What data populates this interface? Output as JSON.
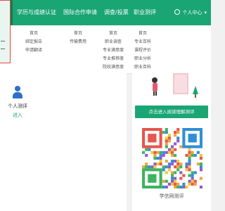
{
  "nav": {
    "active_fragment": "报告",
    "items": [
      {
        "label": "学历与成绩认证"
      },
      {
        "label": "国际合作申请"
      },
      {
        "label": "调查/投票"
      },
      {
        "label": "职业测评"
      }
    ],
    "user_label": "个人中心",
    "user_caret": "▾"
  },
  "dropdown": {
    "columns": [
      [
        "首页",
        "绑定报告",
        "申请翻译"
      ],
      [
        "首页",
        "传输费用"
      ],
      [
        "首页",
        "职业调查",
        "专业满意度",
        "专业推荐度",
        "院校满意度"
      ],
      [
        "首页",
        "专业百科",
        "课程评价",
        "职业分析",
        "职业百科"
      ]
    ]
  },
  "main": {
    "test_title": "个人测评",
    "test_link": "进入",
    "cta_label": "点击进入阅读理解测评",
    "qr_caption": "学信网测评"
  },
  "colors": {
    "brand_green": "#1aa575",
    "highlight_red": "#e44444",
    "icon_blue": "#2f6fc9"
  },
  "icons": [
    "user-gear-icon",
    "person-icon",
    "plant-icon",
    "qr-code"
  ]
}
